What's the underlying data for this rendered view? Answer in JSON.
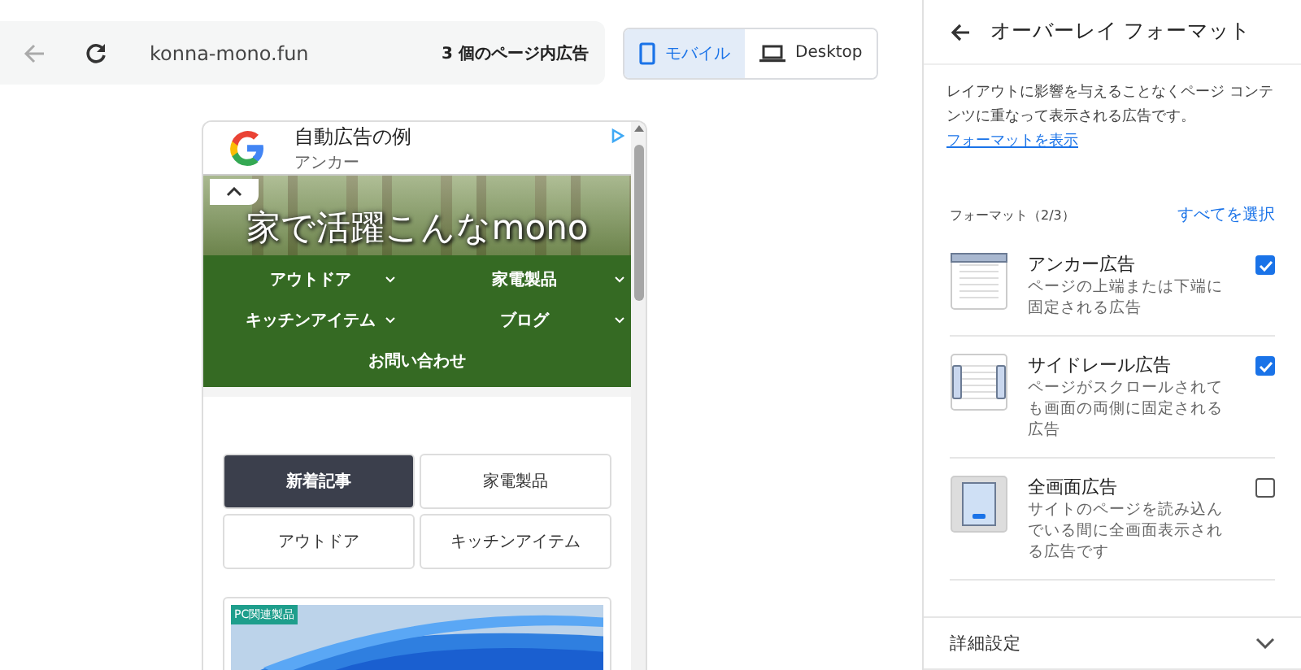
{
  "toolbar": {
    "url": "konna-mono.fun",
    "ad_count": "3 個のページ内広告"
  },
  "device_modes": [
    {
      "label": "モバイル",
      "kind": "mobile",
      "selected": true
    },
    {
      "label": "Desktop",
      "kind": "desktop",
      "selected": false
    }
  ],
  "preview": {
    "anchor_ad": {
      "title": "自動広告の例",
      "subtitle": "アンカー"
    },
    "site_title": "家で活躍こんなmono",
    "nav": [
      {
        "label": "アウトドア",
        "dropdown": true
      },
      {
        "label": "家電製品",
        "dropdown": true
      },
      {
        "label": "キッチンアイテム",
        "dropdown": true
      },
      {
        "label": "ブログ",
        "dropdown": true
      },
      {
        "label": "お問い合わせ",
        "dropdown": false
      }
    ],
    "tabs": [
      {
        "label": "新着記事",
        "selected": true
      },
      {
        "label": "家電製品",
        "selected": false
      },
      {
        "label": "アウトドア",
        "selected": false
      },
      {
        "label": "キッチンアイテム",
        "selected": false
      }
    ],
    "card": {
      "badge": "PC関連製品"
    }
  },
  "panel": {
    "title": "オーバーレイ フォーマット",
    "description": "レイアウトに影響を与えることなくページ コンテンツに重なって表示される広告です。",
    "link": "フォーマットを表示",
    "formats_label": "フォーマット（2/3）",
    "select_all": "すべてを選択",
    "formats": [
      {
        "kind": "anchor",
        "name": "アンカー広告",
        "description": "ページの上端または下端に固定される広告",
        "checked": true
      },
      {
        "kind": "siderail",
        "name": "サイドレール広告",
        "description": "ページがスクロールされても画面の両側に固定される広告",
        "checked": true
      },
      {
        "kind": "fullscreen",
        "name": "全画面広告",
        "description": "サイトのページを読み込んでいる間に全画面表示される広告です",
        "checked": false
      }
    ],
    "advanced": "詳細設定"
  }
}
